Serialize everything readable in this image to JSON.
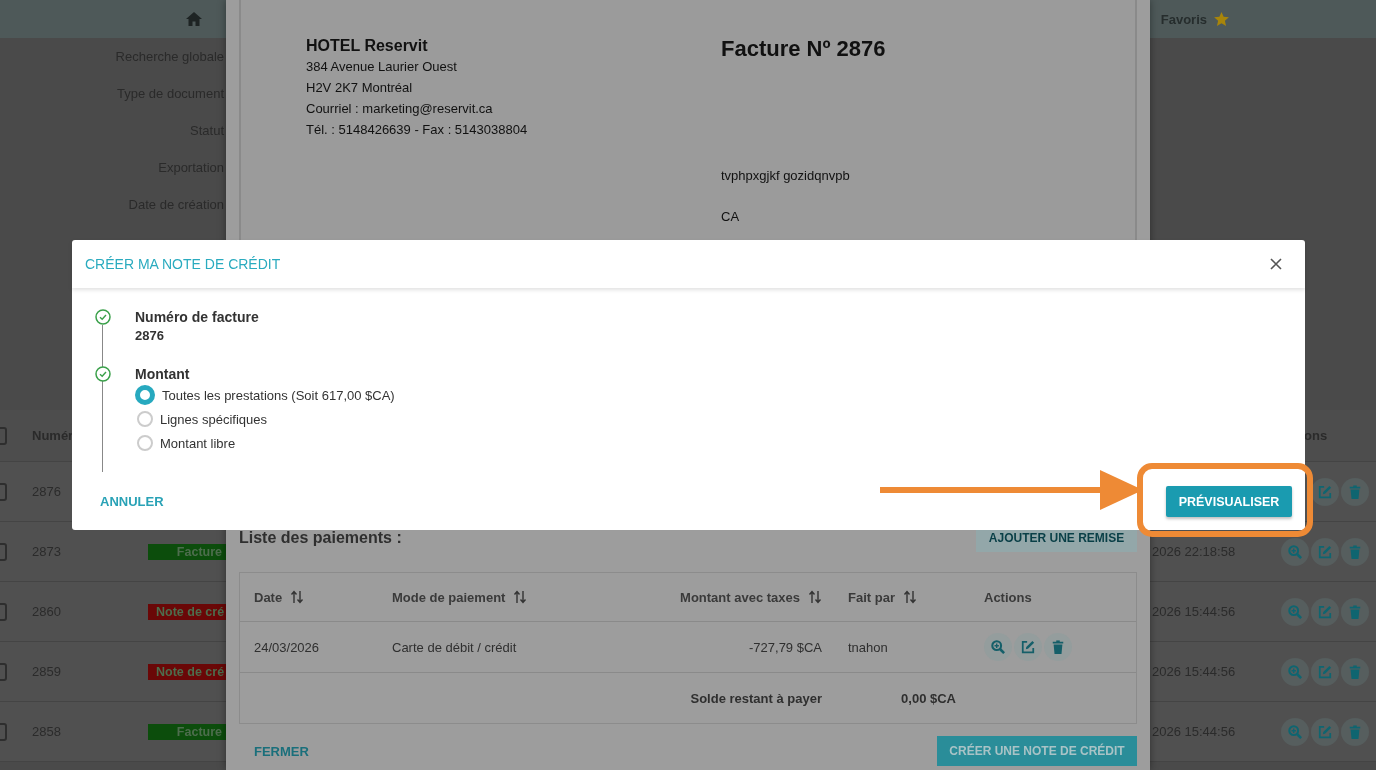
{
  "top_bar": {
    "favorites": "Favoris"
  },
  "filters": [
    "Recherche globale",
    "Type de document",
    "Statut",
    "Exportation",
    "Date de création"
  ],
  "table": {
    "columns": [
      "Numér",
      "ons"
    ],
    "select_all_checked": false,
    "rows": [
      {
        "checked": false,
        "number": "2876",
        "actions": [
          {
            "kind": "edit"
          },
          {
            "kind": "delete"
          }
        ]
      },
      {
        "checked": false,
        "number": "2873",
        "badge": {
          "label": "Facture",
          "color": "#0c4d0c"
        },
        "date": "2026 22:18:58",
        "actions": [
          {
            "kind": "view"
          },
          {
            "kind": "edit"
          },
          {
            "kind": "delete"
          }
        ]
      },
      {
        "checked": false,
        "number": "2860",
        "badge": {
          "label": "Note de cré",
          "color": "#6a0707"
        },
        "date": "2026 15:44:56",
        "actions": [
          {
            "kind": "view"
          },
          {
            "kind": "edit"
          },
          {
            "kind": "delete"
          }
        ]
      },
      {
        "checked": false,
        "number": "2859",
        "badge": {
          "label": "Note de cré",
          "color": "#6a0707"
        },
        "date": "2026 15:44:56",
        "actions": [
          {
            "kind": "view"
          },
          {
            "kind": "edit"
          },
          {
            "kind": "delete"
          }
        ]
      },
      {
        "checked": false,
        "number": "2858",
        "badge": {
          "label": "Facture",
          "color": "#0c4d0c"
        },
        "date": "2026 15:44:56",
        "actions": [
          {
            "kind": "view"
          },
          {
            "kind": "edit"
          },
          {
            "kind": "delete"
          }
        ]
      }
    ]
  },
  "invoice_modal": {
    "hotel": {
      "name": "HOTEL Reservit",
      "lines": [
        "384 Avenue Laurier Ouest",
        "H2V 2K7 Montréal",
        "Courriel : marketing@reservit.ca",
        "Tél. : 5148426639 - Fax : 5143038804"
      ]
    },
    "title": "Facture Nº 2876",
    "client_lines": [
      "tvphpxgjkf gozidqnvpb",
      "CA"
    ],
    "payments_title": "Liste des paiements :",
    "add_discount_button": "AJOUTER UNE REMISE",
    "payments": {
      "columns": [
        {
          "label": "Date",
          "sortable": true
        },
        {
          "label": "Mode de paiement",
          "sortable": true
        },
        {
          "label": "Montant avec taxes",
          "sortable": true
        },
        {
          "label": "Fait par",
          "sortable": true
        },
        {
          "label": "Actions",
          "sortable": false
        }
      ],
      "rows": [
        {
          "cells": [
            "24/03/2026",
            "Carte de débit / crédit",
            "-727,79 $CA",
            "tnahon"
          ],
          "actions": [
            {
              "kind": "view"
            },
            {
              "kind": "edit"
            },
            {
              "kind": "delete"
            }
          ]
        }
      ],
      "balance_label": "Solde restant à payer",
      "balance": "0,00 $CA"
    },
    "close_button": "FERMER",
    "create_button": "CRÉER UNE NOTE DE CRÉDIT"
  },
  "dialog": {
    "title": "CRÉER MA NOTE DE CRÉDIT",
    "steps": [
      {
        "label": "Numéro de facture",
        "value": "2876",
        "done": true
      },
      {
        "label": "Montant",
        "done": true,
        "options": [
          {
            "label": "Toutes les prestations (Soit 617,00 $CA)",
            "selected": true
          },
          {
            "label": "Lignes spécifiques",
            "selected": false
          },
          {
            "label": "Montant libre",
            "selected": false
          }
        ]
      }
    ],
    "cancel_button": "ANNULER",
    "preview_button": "PRÉVISUALISER"
  }
}
